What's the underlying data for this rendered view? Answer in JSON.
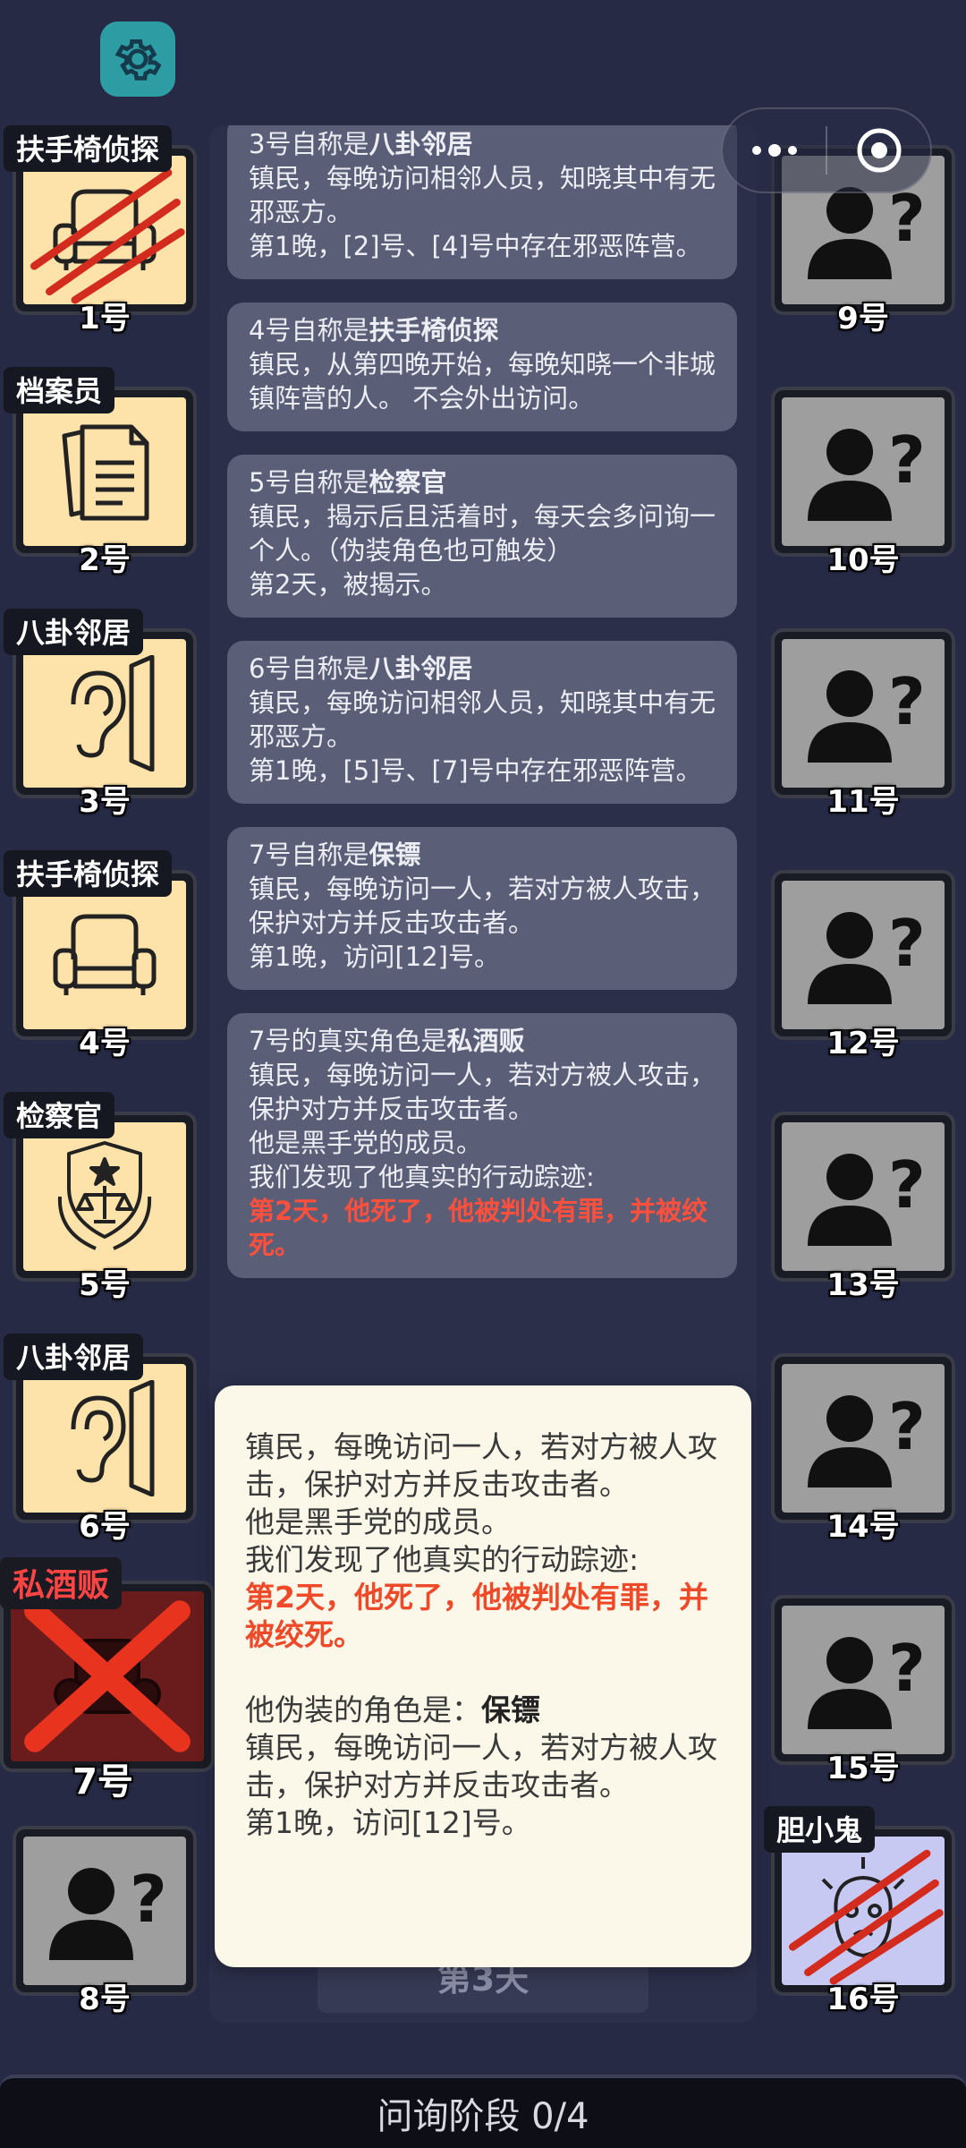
{
  "settings": {
    "icon": "gear-icon"
  },
  "capsule": {
    "more_icon": "more-dots-icon",
    "close_icon": "target-close-icon"
  },
  "players_left": [
    {
      "num": "1号",
      "tag": "扶手椅侦探",
      "icon": "armchair-icon",
      "dead": true
    },
    {
      "num": "2号",
      "tag": "档案员",
      "icon": "documents-icon",
      "dead": false
    },
    {
      "num": "3号",
      "tag": "八卦邻居",
      "icon": "ear-icon",
      "dead": false
    },
    {
      "num": "4号",
      "tag": "扶手椅侦探",
      "icon": "armchair-icon",
      "dead": false
    },
    {
      "num": "5号",
      "tag": "检察官",
      "icon": "justice-badge-icon",
      "dead": false
    },
    {
      "num": "6号",
      "tag": "八卦邻居",
      "icon": "ear-icon",
      "dead": false
    },
    {
      "num": "7号",
      "tag": "私酒贩",
      "icon": "bootlegger-icon",
      "dead": true
    },
    {
      "num": "8号",
      "tag": "",
      "icon": "unknown-person-icon",
      "dead": false
    }
  ],
  "players_right": [
    {
      "num": "9号",
      "icon": "unknown-person-icon"
    },
    {
      "num": "10号",
      "icon": "unknown-person-icon"
    },
    {
      "num": "11号",
      "icon": "unknown-person-icon"
    },
    {
      "num": "12号",
      "icon": "unknown-person-icon"
    },
    {
      "num": "13号",
      "icon": "unknown-person-icon"
    },
    {
      "num": "14号",
      "icon": "unknown-person-icon"
    },
    {
      "num": "15号",
      "icon": "unknown-person-icon"
    },
    {
      "num": "16号",
      "tag": "胆小鬼",
      "icon": "coward-icon",
      "dead": true
    }
  ],
  "log": {
    "card1": {
      "title_prefix": "3号自称是",
      "title_role": "八卦邻居",
      "desc": "镇民，每晚访问相邻人员，知晓其中有无邪恶方。",
      "detail": "第1晚，[2]号、[4]号中存在邪恶阵营。"
    },
    "card2": {
      "title_prefix": "4号自称是",
      "title_role": "扶手椅侦探",
      "desc": "镇民，从第四晚开始，每晚知晓一个非城镇阵营的人。 不会外出访问。"
    },
    "card3": {
      "title_prefix": "5号自称是",
      "title_role": "检察官",
      "desc": "镇民，揭示后且活着时，每天会多问询一个人。（伪装角色也可触发）",
      "detail": "第2天，被揭示。"
    },
    "card4": {
      "title_prefix": "6号自称是",
      "title_role": "八卦邻居",
      "desc": "镇民，每晚访问相邻人员，知晓其中有无邪恶方。",
      "detail": "第1晚，[5]号、[7]号中存在邪恶阵营。"
    },
    "card5": {
      "title_prefix": "7号自称是",
      "title_role": "保镖",
      "desc": "镇民，每晚访问一人，若对方被人攻击，保护对方并反击攻击者。",
      "detail": "第1晚，访问[12]号。"
    },
    "card6": {
      "title_prefix": "7号的真实角色是",
      "title_role": "私酒贩",
      "desc": "镇民，每晚访问一人，若对方被人攻击，保护对方并反击攻击者。",
      "line1": "他是黑手党的成员。",
      "line2": "我们发现了他真实的行动踪迹:",
      "red": "第2天，他死了，他被判处有罪，并被绞死。"
    }
  },
  "popup": {
    "desc": "镇民，每晚访问一人，若对方被人攻击，保护对方并反击攻击者。",
    "line1": "他是黑手党的成员。",
    "line2": "我们发现了他真实的行动踪迹:",
    "red": "第2天，他死了，他被判处有罪，并被绞死。",
    "disguise_prefix": "他伪装的角色是：",
    "disguise_role": "保镖",
    "disguise_desc": "镇民，每晚访问一人，若对方被人攻击，保护对方并反击攻击者。",
    "disguise_detail": "第1晚，访问[12]号。"
  },
  "day_label": "第3天",
  "phase": "问询阶段 0/4"
}
